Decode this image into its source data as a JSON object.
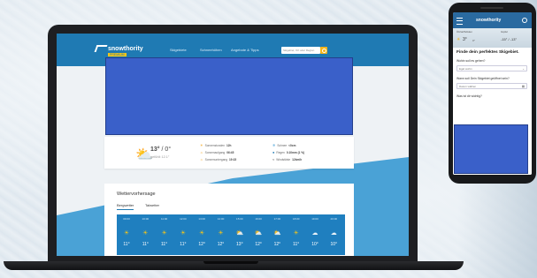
{
  "brand": {
    "name": "snowthority",
    "tagline": "PREMIUM"
  },
  "nav": {
    "links": [
      "Skigebiete",
      "Schneehöhen",
      "Angebote & Tipps"
    ],
    "search_placeholder": "Skigebiet, Ort oder Region"
  },
  "summary": {
    "temp_main": "13°",
    "temp_low": "/ 0°",
    "feels_like": "gefühlt 12.1°",
    "stats": [
      {
        "icon": "sun-icon",
        "label": "Sonnenstunden",
        "value": "12h"
      },
      {
        "icon": "sunrise-icon",
        "label": "Sonnenaufgang",
        "value": "06:45"
      },
      {
        "icon": "sunset-icon",
        "label": "Sonnenuntergang",
        "value": "19:15"
      },
      {
        "icon": "snowflake-icon",
        "label": "Schnee",
        "value": "<0cm"
      },
      {
        "icon": "raindrop-icon",
        "label": "Regen",
        "value": "0.10mm (1 %)"
      },
      {
        "icon": "wind-icon",
        "label": "Windstärke",
        "value": "12km/h"
      }
    ]
  },
  "forecast": {
    "title": "Wettervorhersage",
    "tabs": [
      "Bergwetter",
      "Talwetter"
    ],
    "hours": [
      {
        "time": "09:00",
        "icon": "sun-icon",
        "temp": "11°"
      },
      {
        "time": "10:00",
        "icon": "sun-icon",
        "temp": "11°"
      },
      {
        "time": "11:00",
        "icon": "sun-icon",
        "temp": "11°"
      },
      {
        "time": "12:00",
        "icon": "sun-icon",
        "temp": "11°"
      },
      {
        "time": "13:00",
        "icon": "sun-icon",
        "temp": "12°"
      },
      {
        "time": "14:00",
        "icon": "sun-icon",
        "temp": "12°"
      },
      {
        "time": "15:00",
        "icon": "cloud-sun-icon",
        "temp": "13°"
      },
      {
        "time": "16:00",
        "icon": "cloud-sun-icon",
        "temp": "12°"
      },
      {
        "time": "17:00",
        "icon": "cloud-sun-icon",
        "temp": "12°"
      },
      {
        "time": "18:00",
        "icon": "sun-icon",
        "temp": "11°"
      },
      {
        "time": "19:00",
        "icon": "cloud-icon",
        "temp": "10°"
      },
      {
        "time": "20:00",
        "icon": "cloud-icon",
        "temp": "10°"
      }
    ]
  },
  "phone": {
    "labels": {
      "left": "Ötztal/Sölden",
      "right": "Gipfel"
    },
    "temps": {
      "left": "3°",
      "left_sub": "0°",
      "right": "-15° / -13°"
    },
    "heading": "Finde dein perfektes Skigebiet.",
    "q1": "Wohin soll es gehen?",
    "q1_value": "Egal wohin",
    "q2": "Wann soll Dein Skigebiet geöffnet sein?",
    "q2_value": "Datum wählen",
    "q3": "Was ist dir wichtig?"
  },
  "colors": {
    "brand_blue": "#1f7ab3",
    "accent_yellow": "#f5b51b",
    "ad_blue": "#3a60c9"
  }
}
